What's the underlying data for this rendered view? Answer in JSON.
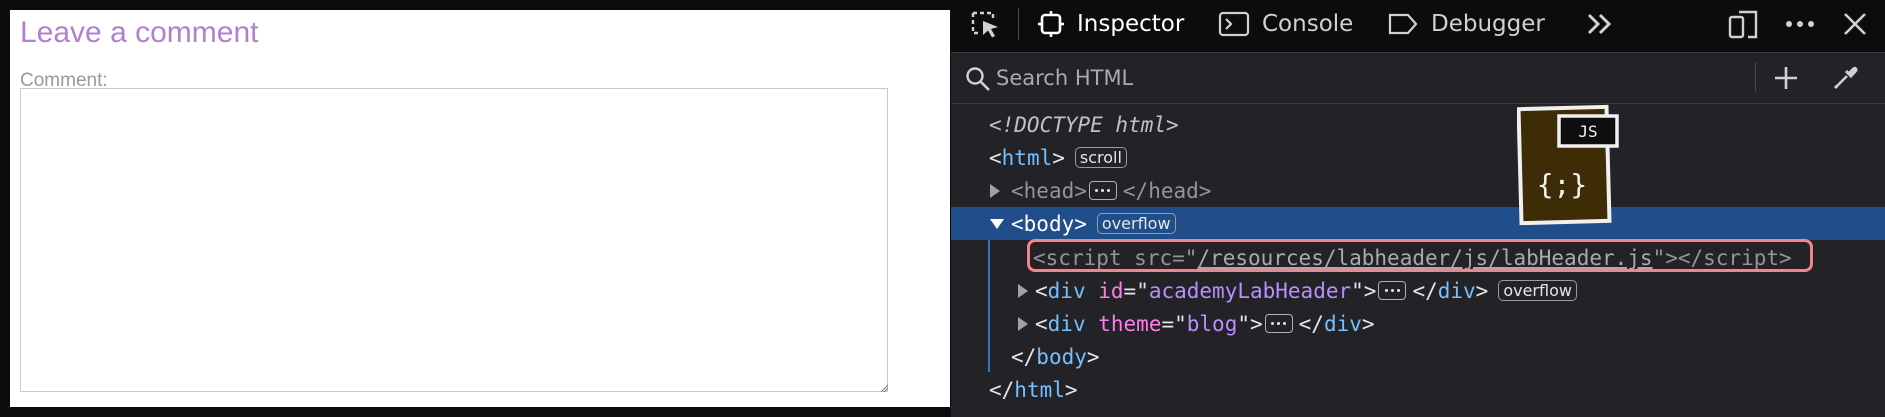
{
  "page": {
    "title": "Leave a comment",
    "comment_label": "Comment:",
    "comment_value": ""
  },
  "devtools": {
    "tabs": [
      {
        "label": "Inspector",
        "icon": "inspector-icon",
        "active": true
      },
      {
        "label": "Console",
        "icon": "console-icon",
        "active": false
      },
      {
        "label": "Debugger",
        "icon": "debugger-icon",
        "active": false
      }
    ],
    "search_placeholder": "Search HTML",
    "tree": {
      "doctype": "<!DOCTYPE html>",
      "html_open": "html",
      "html_badge": "scroll",
      "head": "head",
      "body": "body",
      "body_badge": "overflow",
      "script_tag": "script",
      "script_attr": "src",
      "script_src": "/resources/labheader/js/labHeader.js",
      "div1_tag": "div",
      "div1_attr": "id",
      "div1_val": "academyLabHeader",
      "div1_badge": "overflow",
      "div2_tag": "div",
      "div2_attr": "theme",
      "div2_val": "blog",
      "body_close": "body",
      "html_close": "html"
    },
    "js_badge_label": "JS",
    "js_badge_glyph": "{;}"
  },
  "colors": {
    "page_title": "#b47fd0",
    "selected_row": "#204e8a",
    "tag": "#75bfff",
    "attr": "#ff7de9",
    "value": "#b98eff",
    "highlight": "#f3848c"
  }
}
